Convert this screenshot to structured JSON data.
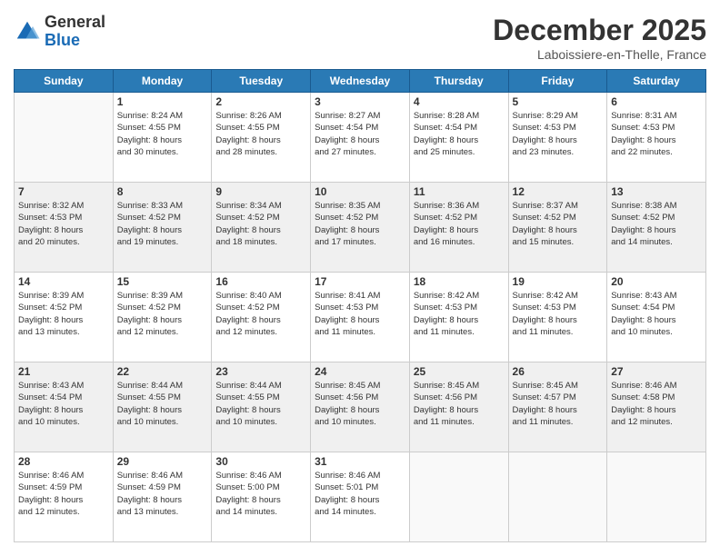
{
  "header": {
    "logo": {
      "general": "General",
      "blue": "Blue"
    },
    "title": "December 2025",
    "location": "Laboissiere-en-Thelle, France"
  },
  "weekdays": [
    "Sunday",
    "Monday",
    "Tuesday",
    "Wednesday",
    "Thursday",
    "Friday",
    "Saturday"
  ],
  "weeks": [
    [
      {
        "day": "",
        "info": ""
      },
      {
        "day": "1",
        "info": "Sunrise: 8:24 AM\nSunset: 4:55 PM\nDaylight: 8 hours\nand 30 minutes."
      },
      {
        "day": "2",
        "info": "Sunrise: 8:26 AM\nSunset: 4:55 PM\nDaylight: 8 hours\nand 28 minutes."
      },
      {
        "day": "3",
        "info": "Sunrise: 8:27 AM\nSunset: 4:54 PM\nDaylight: 8 hours\nand 27 minutes."
      },
      {
        "day": "4",
        "info": "Sunrise: 8:28 AM\nSunset: 4:54 PM\nDaylight: 8 hours\nand 25 minutes."
      },
      {
        "day": "5",
        "info": "Sunrise: 8:29 AM\nSunset: 4:53 PM\nDaylight: 8 hours\nand 23 minutes."
      },
      {
        "day": "6",
        "info": "Sunrise: 8:31 AM\nSunset: 4:53 PM\nDaylight: 8 hours\nand 22 minutes."
      }
    ],
    [
      {
        "day": "7",
        "info": "Sunrise: 8:32 AM\nSunset: 4:53 PM\nDaylight: 8 hours\nand 20 minutes."
      },
      {
        "day": "8",
        "info": "Sunrise: 8:33 AM\nSunset: 4:52 PM\nDaylight: 8 hours\nand 19 minutes."
      },
      {
        "day": "9",
        "info": "Sunrise: 8:34 AM\nSunset: 4:52 PM\nDaylight: 8 hours\nand 18 minutes."
      },
      {
        "day": "10",
        "info": "Sunrise: 8:35 AM\nSunset: 4:52 PM\nDaylight: 8 hours\nand 17 minutes."
      },
      {
        "day": "11",
        "info": "Sunrise: 8:36 AM\nSunset: 4:52 PM\nDaylight: 8 hours\nand 16 minutes."
      },
      {
        "day": "12",
        "info": "Sunrise: 8:37 AM\nSunset: 4:52 PM\nDaylight: 8 hours\nand 15 minutes."
      },
      {
        "day": "13",
        "info": "Sunrise: 8:38 AM\nSunset: 4:52 PM\nDaylight: 8 hours\nand 14 minutes."
      }
    ],
    [
      {
        "day": "14",
        "info": "Sunrise: 8:39 AM\nSunset: 4:52 PM\nDaylight: 8 hours\nand 13 minutes."
      },
      {
        "day": "15",
        "info": "Sunrise: 8:39 AM\nSunset: 4:52 PM\nDaylight: 8 hours\nand 12 minutes."
      },
      {
        "day": "16",
        "info": "Sunrise: 8:40 AM\nSunset: 4:52 PM\nDaylight: 8 hours\nand 12 minutes."
      },
      {
        "day": "17",
        "info": "Sunrise: 8:41 AM\nSunset: 4:53 PM\nDaylight: 8 hours\nand 11 minutes."
      },
      {
        "day": "18",
        "info": "Sunrise: 8:42 AM\nSunset: 4:53 PM\nDaylight: 8 hours\nand 11 minutes."
      },
      {
        "day": "19",
        "info": "Sunrise: 8:42 AM\nSunset: 4:53 PM\nDaylight: 8 hours\nand 11 minutes."
      },
      {
        "day": "20",
        "info": "Sunrise: 8:43 AM\nSunset: 4:54 PM\nDaylight: 8 hours\nand 10 minutes."
      }
    ],
    [
      {
        "day": "21",
        "info": "Sunrise: 8:43 AM\nSunset: 4:54 PM\nDaylight: 8 hours\nand 10 minutes."
      },
      {
        "day": "22",
        "info": "Sunrise: 8:44 AM\nSunset: 4:55 PM\nDaylight: 8 hours\nand 10 minutes."
      },
      {
        "day": "23",
        "info": "Sunrise: 8:44 AM\nSunset: 4:55 PM\nDaylight: 8 hours\nand 10 minutes."
      },
      {
        "day": "24",
        "info": "Sunrise: 8:45 AM\nSunset: 4:56 PM\nDaylight: 8 hours\nand 10 minutes."
      },
      {
        "day": "25",
        "info": "Sunrise: 8:45 AM\nSunset: 4:56 PM\nDaylight: 8 hours\nand 11 minutes."
      },
      {
        "day": "26",
        "info": "Sunrise: 8:45 AM\nSunset: 4:57 PM\nDaylight: 8 hours\nand 11 minutes."
      },
      {
        "day": "27",
        "info": "Sunrise: 8:46 AM\nSunset: 4:58 PM\nDaylight: 8 hours\nand 12 minutes."
      }
    ],
    [
      {
        "day": "28",
        "info": "Sunrise: 8:46 AM\nSunset: 4:59 PM\nDaylight: 8 hours\nand 12 minutes."
      },
      {
        "day": "29",
        "info": "Sunrise: 8:46 AM\nSunset: 4:59 PM\nDaylight: 8 hours\nand 13 minutes."
      },
      {
        "day": "30",
        "info": "Sunrise: 8:46 AM\nSunset: 5:00 PM\nDaylight: 8 hours\nand 14 minutes."
      },
      {
        "day": "31",
        "info": "Sunrise: 8:46 AM\nSunset: 5:01 PM\nDaylight: 8 hours\nand 14 minutes."
      },
      {
        "day": "",
        "info": ""
      },
      {
        "day": "",
        "info": ""
      },
      {
        "day": "",
        "info": ""
      }
    ]
  ]
}
